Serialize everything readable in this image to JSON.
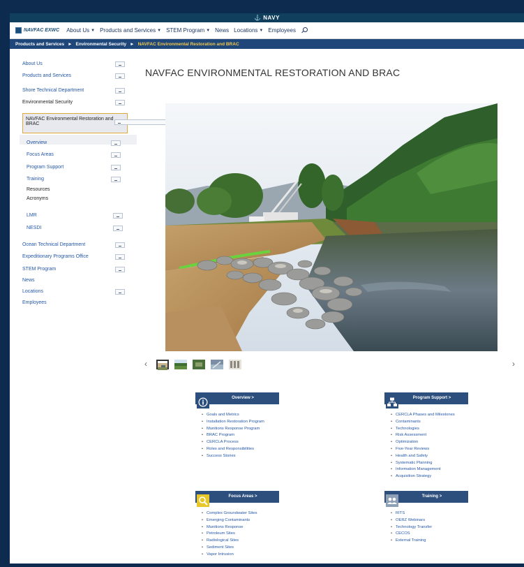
{
  "header": {
    "navy_label": "NAVY",
    "brand": "NAVFAC EXWC",
    "nav_items": [
      {
        "label": "About Us",
        "has_caret": true
      },
      {
        "label": "Products and Services",
        "has_caret": true
      },
      {
        "label": "STEM Program",
        "has_caret": true
      },
      {
        "label": "News",
        "has_caret": false
      },
      {
        "label": "Locations",
        "has_caret": true
      },
      {
        "label": "Employees",
        "has_caret": false
      }
    ],
    "icons": {
      "search": "search-icon"
    }
  },
  "breadcrumb": {
    "items": [
      "Products and Services",
      "Environmental Security",
      "NAVFAC Environmental Restoration and BRAC"
    ],
    "separator": "►"
  },
  "sidebar": {
    "about": "About Us",
    "products": "Products and Services",
    "shore": "Shore Technical Department",
    "env_security": "Environmental Security",
    "active": "NAVFAC Environmental Restoration and BRAC",
    "overview": "Overview",
    "focus": "Focus Areas",
    "program_support": "Program Support",
    "training": "Training",
    "resources": "Resources",
    "acronyms": "Acronyms",
    "lmr": "LMR",
    "nesdi": "NESDI",
    "ocean": "Ocean Technical Department",
    "expeditionary": "Expeditionary Programs Office",
    "stem": "STEM Program",
    "news": "News",
    "locations": "Locations",
    "employees": "Employees"
  },
  "main": {
    "title": "NAVFAC ENVIRONMENTAL RESTORATION AND BRAC",
    "carousel": {
      "prev": "‹",
      "next": "›",
      "thumb_count": 5
    }
  },
  "cards": {
    "overview": {
      "label": "Overview >",
      "icon": "info-icon",
      "items": [
        "Goals and Metrics",
        "Installation Restoration Program",
        "Munitions Response Program",
        "BRAC Program",
        "CERCLA Process",
        "Roles and Responsibilities",
        "Success Stories"
      ]
    },
    "program_support": {
      "label": "Program Support >",
      "icon": "network-icon",
      "items": [
        "CERCLA Phases and Milestones",
        "Contaminants",
        "Technologies",
        "Risk Assessment",
        "Optimization",
        "Five-Year Reviews",
        "Health and Safety",
        "Systematic Planning",
        "Information Management",
        "Acquisition Strategy"
      ]
    },
    "focus_areas": {
      "label": "Focus Areas >",
      "icon": "magnifier-icon",
      "items": [
        "Complex Groundwater Sites",
        "Emerging Contaminants",
        "Munitions Response",
        "Petroleum Sites",
        "Radiological Sites",
        "Sediment Sites",
        "Vapor Intrusion"
      ]
    },
    "training": {
      "label": "Training >",
      "icon": "people-icon",
      "items": [
        "RITS",
        "OERZ Webinars",
        "Technology Transfer",
        "CECOS",
        "External Training"
      ]
    }
  },
  "colors": {
    "accent": "#2d4f7e",
    "breadcrumb_bg": "#20477a",
    "active_border": "#e0a93a",
    "link": "#2457a8"
  }
}
